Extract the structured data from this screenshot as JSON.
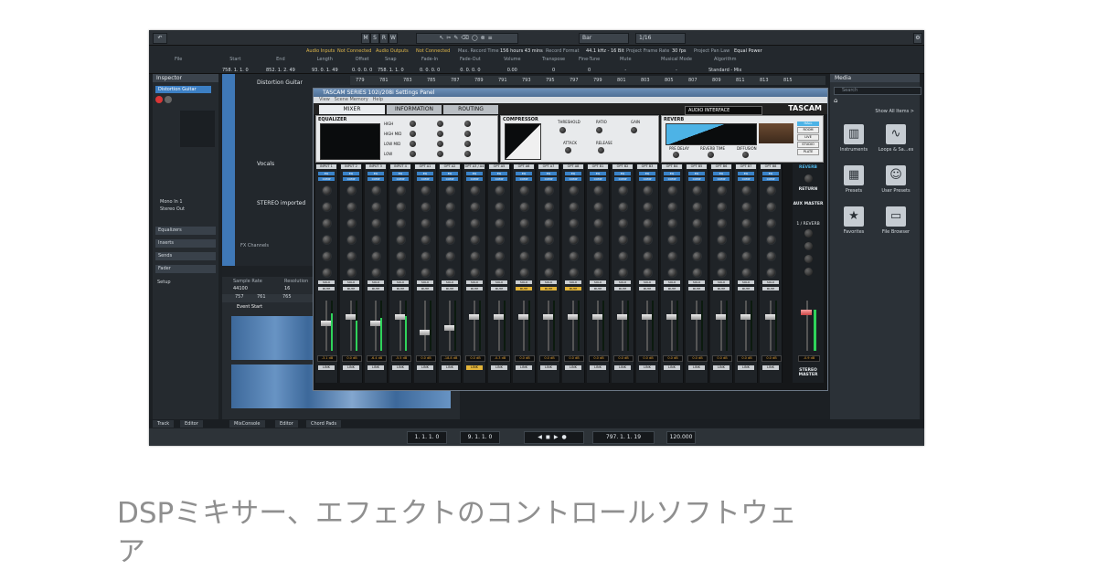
{
  "caption": {
    "line1": "DSPミキサー、エフェクトのコントロールソフトウェ",
    "line2": "ア"
  },
  "daw": {
    "toolbar": {
      "buttons": [
        "M",
        "S",
        "R",
        "W"
      ],
      "snap_value": "Bar",
      "quantize_value": "1/16"
    },
    "infobar": [
      {
        "label": "File",
        "value": ""
      },
      {
        "label": "Start",
        "value": "758. 1. 1. 0"
      },
      {
        "label": "End",
        "value": "852. 1. 2. 49"
      },
      {
        "label": "Length",
        "value": "93. 0. 1. 49"
      },
      {
        "label": "Offset",
        "value": "0. 0. 0. 0"
      },
      {
        "label": "Snap",
        "value": "758. 1. 1. 0"
      },
      {
        "label": "Fade-In",
        "value": "0. 0. 0. 0"
      },
      {
        "label": "Fade-Out",
        "value": "0. 0. 0. 0"
      },
      {
        "label": "Volume",
        "value": "0.00"
      },
      {
        "label": "Transpose",
        "value": "0"
      },
      {
        "label": "Fine-Tune",
        "value": "0"
      },
      {
        "label": "Mute",
        "value": "-"
      },
      {
        "label": "Musical Mode",
        "value": "-"
      },
      {
        "label": "Algorithm",
        "value": "Standard - Mix"
      }
    ],
    "status": {
      "audio_inputs": "Audio Inputs",
      "not_connected_1": "Not Connected",
      "audio_outputs": "Audio Outputs",
      "not_connected_2": "Not Connected",
      "max_record_time": "Max. Record Time",
      "record_time_value": "156 hours 43 mins",
      "record_format": "Record Format",
      "record_format_value": "44.1 kHz - 16 Bit",
      "frame_rate": "Project Frame Rate",
      "frame_rate_value": "30 fps",
      "pan_law": "Project Pan Law",
      "pan_law_value": "Equal Power"
    },
    "inspector": {
      "title": "Inspector",
      "track_name": "Distortion Guitar",
      "routing_1": "Mono In 1",
      "routing_2": "Stereo Out",
      "sections": [
        "Equalizers",
        "Inserts",
        "Sends",
        "Fader"
      ],
      "setup": "Setup"
    },
    "tracks": [
      {
        "name": "Distortion Guitar"
      },
      {
        "name": "Vocals"
      },
      {
        "name": "STEREO imported"
      },
      {
        "name": "FX Channels"
      }
    ],
    "ruler_ticks": [
      "779",
      "781",
      "783",
      "785",
      "787",
      "789",
      "791",
      "793",
      "795",
      "797",
      "799",
      "801",
      "803",
      "805",
      "807",
      "809",
      "811",
      "813",
      "815"
    ],
    "editor": {
      "sample_rate_label": "Sample Rate",
      "sample_rate_value": "44100",
      "resolution_label": "Resolution",
      "resolution_value": "16",
      "ticks": [
        "757",
        "761",
        "765"
      ],
      "event_start": "Event Start"
    },
    "media": {
      "title": "Media",
      "search_placeholder": "Search",
      "show_all": "Show All Items >",
      "items": [
        {
          "label": "Instruments",
          "icon": "piano-icon"
        },
        {
          "label": "Loops & Sa...es",
          "icon": "waveform-icon"
        },
        {
          "label": "Presets",
          "icon": "presets-icon"
        },
        {
          "label": "User Presets",
          "icon": "user-icon"
        },
        {
          "label": "Favorites",
          "icon": "star-icon"
        },
        {
          "label": "File Browser",
          "icon": "drive-icon"
        }
      ]
    },
    "bottom_tabs": [
      "Track",
      "Editor",
      "MixConsole",
      "Editor",
      "Chord Pads"
    ],
    "transport": {
      "left_locator": "1. 1. 1. 0",
      "right_locator": "9. 1. 1. 0",
      "position": "797. 1. 1. 19",
      "tempo": "120.000"
    }
  },
  "tascam": {
    "window_title": "TASCAM SERIES 102i/208i Settings Panel",
    "menu": [
      "View",
      "Scene Memory",
      "Help"
    ],
    "tabs": [
      "MIXER",
      "INFORMATION",
      "ROUTING"
    ],
    "audio_interface": "AUDIO INTERFACE",
    "brand": "TASCAM",
    "sections": {
      "equalizer": "EQUALIZER",
      "compressor": "COMPRESSOR",
      "reverb": "REVERB",
      "eq_bands": [
        "HIGH",
        "HIGH MID",
        "LOW MID",
        "LOW"
      ],
      "comp_params": [
        "THRESHOLD",
        "RATIO",
        "GAIN",
        "ATTACK",
        "RELEASE"
      ],
      "reverb_params": [
        "PRE DELAY",
        "REVERB TIME",
        "DIFFUSION"
      ],
      "reverb_types": [
        "HALL",
        "ROOM",
        "LIVE",
        "STUDIO",
        "PLATE"
      ]
    },
    "channels": [
      {
        "name": "INPUT 1",
        "fader": 0.55,
        "db": "-3.1 dB",
        "mute": false,
        "link": false,
        "meter": 0.75
      },
      {
        "name": "INPUT 2",
        "fader": 0.7,
        "db": "0.0 dB",
        "mute": false,
        "link": false,
        "meter": 0.6
      },
      {
        "name": "INPUT 3",
        "fader": 0.55,
        "db": "-6.4 dB",
        "mute": false,
        "link": false,
        "meter": 0.65
      },
      {
        "name": "INPUT 4",
        "fader": 0.7,
        "db": "-5.5 dB",
        "mute": false,
        "link": false,
        "meter": 0.7
      },
      {
        "name": "OPT A1",
        "fader": 0.35,
        "db": "0.0 dB",
        "mute": false,
        "link": false,
        "meter": 0
      },
      {
        "name": "OPT A2",
        "fader": 0.45,
        "db": "-18.8 dB",
        "mute": false,
        "link": false,
        "meter": 0
      },
      {
        "name": "OPT A3 / A4",
        "fader": 0.7,
        "db": "0.0 dB",
        "mute": false,
        "link": true,
        "meter": 0
      },
      {
        "name": "OPT A5",
        "fader": 0.7,
        "db": "-0.3 dB",
        "mute": false,
        "link": false,
        "meter": 0
      },
      {
        "name": "OPT A6",
        "fader": 0.7,
        "db": "0.0 dB",
        "mute": true,
        "link": false,
        "meter": 0
      },
      {
        "name": "OPT A7",
        "fader": 0.7,
        "db": "0.0 dB",
        "mute": true,
        "link": false,
        "meter": 0
      },
      {
        "name": "OPT A8",
        "fader": 0.7,
        "db": "0.0 dB",
        "mute": true,
        "link": false,
        "meter": 0
      },
      {
        "name": "OPT B1",
        "fader": 0.7,
        "db": "0.0 dB",
        "mute": false,
        "link": false,
        "meter": 0
      },
      {
        "name": "OPT B2",
        "fader": 0.7,
        "db": "0.0 dB",
        "mute": false,
        "link": false,
        "meter": 0
      },
      {
        "name": "OPT B3",
        "fader": 0.7,
        "db": "0.0 dB",
        "mute": false,
        "link": false,
        "meter": 0
      },
      {
        "name": "OPT B4",
        "fader": 0.7,
        "db": "0.0 dB",
        "mute": false,
        "link": false,
        "meter": 0
      },
      {
        "name": "OPT B5",
        "fader": 0.7,
        "db": "0.0 dB",
        "mute": false,
        "link": false,
        "meter": 0
      },
      {
        "name": "OPT B6",
        "fader": 0.7,
        "db": "0.0 dB",
        "mute": false,
        "link": false,
        "meter": 0
      },
      {
        "name": "OPT B7",
        "fader": 0.7,
        "db": "0.0 dB",
        "mute": false,
        "link": false,
        "meter": 0
      },
      {
        "name": "OPT B8",
        "fader": 0.7,
        "db": "0.0 dB",
        "mute": false,
        "link": false,
        "meter": 0
      }
    ],
    "strip_labels": {
      "eq": "EQ",
      "comp": "COMP",
      "aux": "AUX",
      "solo": "SOLO",
      "mute": "MUTE",
      "link": "LINK"
    },
    "master": {
      "reverb": "REVERB",
      "return": "RETURN",
      "aux_master": "AUX MASTER",
      "reverb_send": "1 / REVERB",
      "stereo_master": "STEREO MASTER",
      "db": "-0.9 dB"
    }
  }
}
